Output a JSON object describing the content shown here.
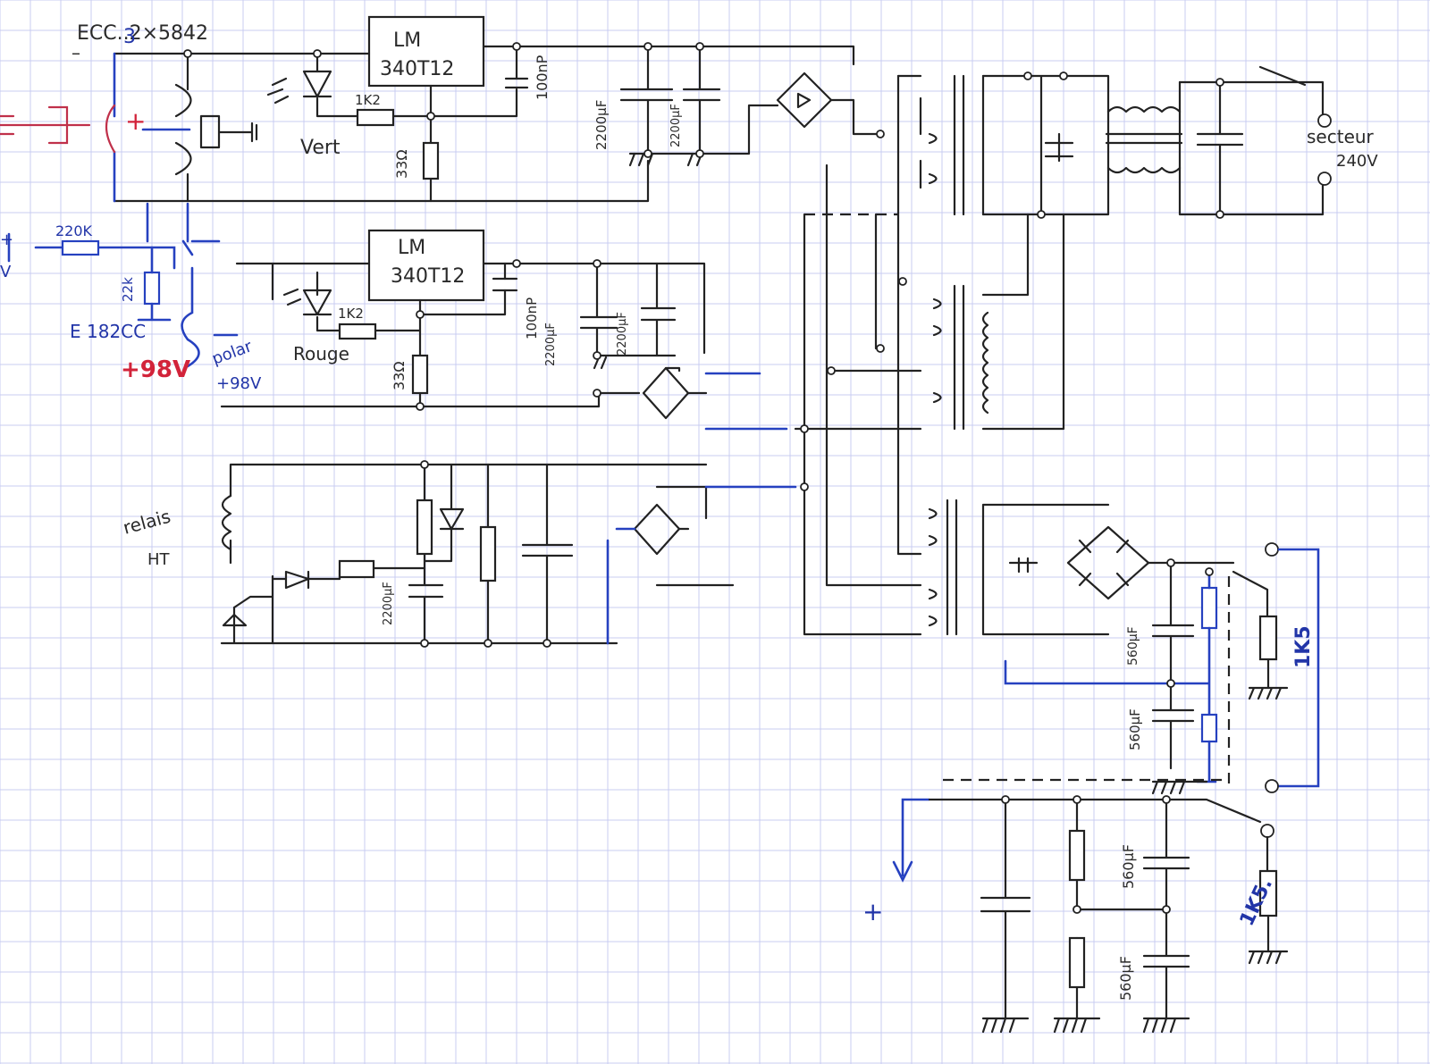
{
  "colors": {
    "ink": "#222222",
    "blue_ink": "#2641c0",
    "red_ink": "#d2233a",
    "grid": "#c8ccf2"
  },
  "labels": {
    "tubes": "ECC..2×5842",
    "tube_marker": "3",
    "reg1_line1": "LM",
    "reg1_line2": "340T12",
    "reg2_line1": "LM",
    "reg2_line2": "340T12",
    "r_1k2_top": "1K2",
    "r_1k2_mid": "1K2",
    "r_33_top": "33Ω",
    "r_33_mid": "33Ω",
    "c_100n_top": "100nP",
    "c_100n_mid": "100nP",
    "c_2200_a": "2200µF",
    "c_2200_b": "2200µF",
    "c_2200_c": "2200µF",
    "c_2200_d": "2200µF",
    "c_2200_relay": "2200µF",
    "led_green": "Vert",
    "led_red": "Rouge",
    "r_220k": "220K",
    "r_22k": "22k",
    "tube_e182": "E 182CC",
    "plus98_red": "+98V",
    "polar_1": "polar",
    "polar_2": "+98V",
    "relay_1": "relais",
    "relay_2": "HT",
    "mains_1": "secteur",
    "mains_2": "240V",
    "c_560_a": "560µF",
    "c_560_b": "560µF",
    "c_560_c": "560µF",
    "c_560_d": "560µF",
    "r_1k5_a": "1K5",
    "r_1k5_b": "1K5.",
    "plus_out": "+",
    "plus_left": "+",
    "left_v": "V",
    "minus": "–"
  }
}
